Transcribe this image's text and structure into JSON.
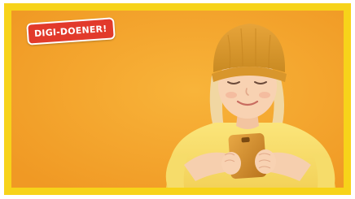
{
  "badge": {
    "label": "DIGI-DOENER!",
    "background_color": "#e23a2b",
    "text_color": "#ffffff"
  },
  "frame": {
    "border_color": "#f7d31a",
    "background_color": "#f5a12a"
  },
  "photo": {
    "subject": "child-with-smartphone-photo"
  }
}
